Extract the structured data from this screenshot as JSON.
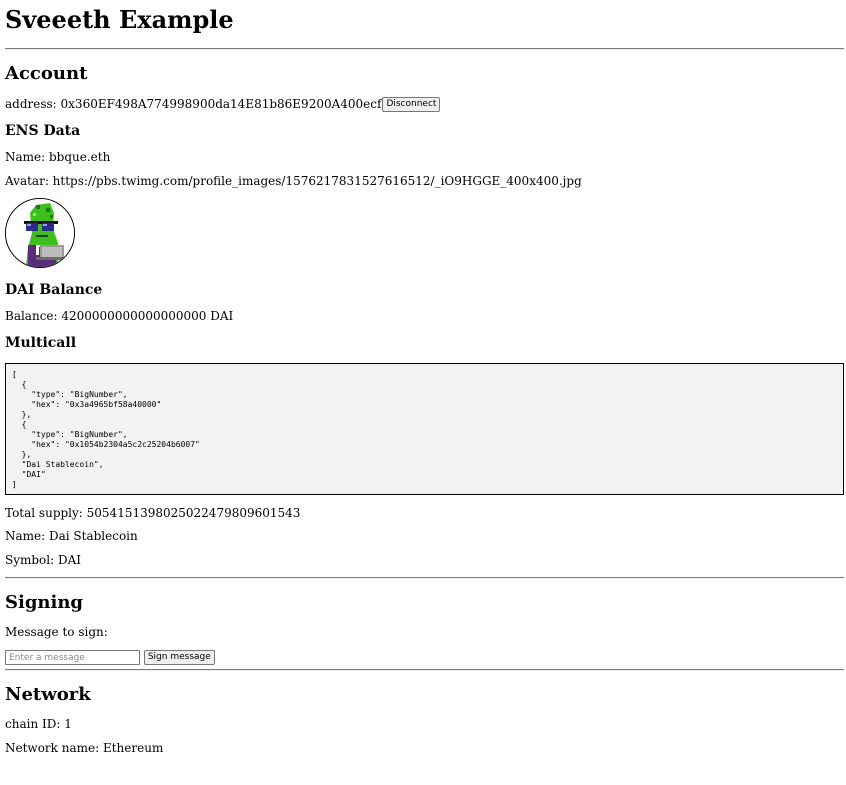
{
  "page": {
    "title": "Sveeeth Example"
  },
  "account": {
    "heading": "Account",
    "address_label": "address: ",
    "address": "0x360EF498A774998900da14E81b86E9200A400ecf",
    "disconnect_label": "Disconnect"
  },
  "ens": {
    "heading": "ENS Data",
    "name_line": "Name: bbque.eth",
    "avatar_line": "Avatar: https://pbs.twimg.com/profile_images/1576217831527616512/_iO9HGGE_400x400.jpg"
  },
  "dai": {
    "heading": "DAI Balance",
    "balance_line": "Balance: 4200000000000000000 DAI"
  },
  "multicall": {
    "heading": "Multicall",
    "json": "[\n  {\n    \"type\": \"BigNumber\",\n    \"hex\": \"0x3a4965bf58a40000\"\n  },\n  {\n    \"type\": \"BigNumber\",\n    \"hex\": \"0x1054b2304a5c2c25204b6007\"\n  },\n  \"Dai Stablecoin\",\n  \"DAI\"\n]",
    "total_supply_line": "Total supply: 5054151398025022479809601543",
    "name_line": "Name: Dai Stablecoin",
    "symbol_line": "Symbol: DAI"
  },
  "signing": {
    "heading": "Signing",
    "message_label": "Message to sign:",
    "message_value": "",
    "message_placeholder": "Enter a message",
    "sign_label": "Sign message"
  },
  "network": {
    "heading": "Network",
    "chain_line": "chain ID: 1",
    "name_line": "Network name: Ethereum"
  },
  "colors": {
    "rule": "#7a7a7a",
    "pre_background": "#f2f2f2",
    "avatar_green": "#3fbf1f"
  },
  "icons": {
    "avatar": "pickle-avatar-image"
  }
}
